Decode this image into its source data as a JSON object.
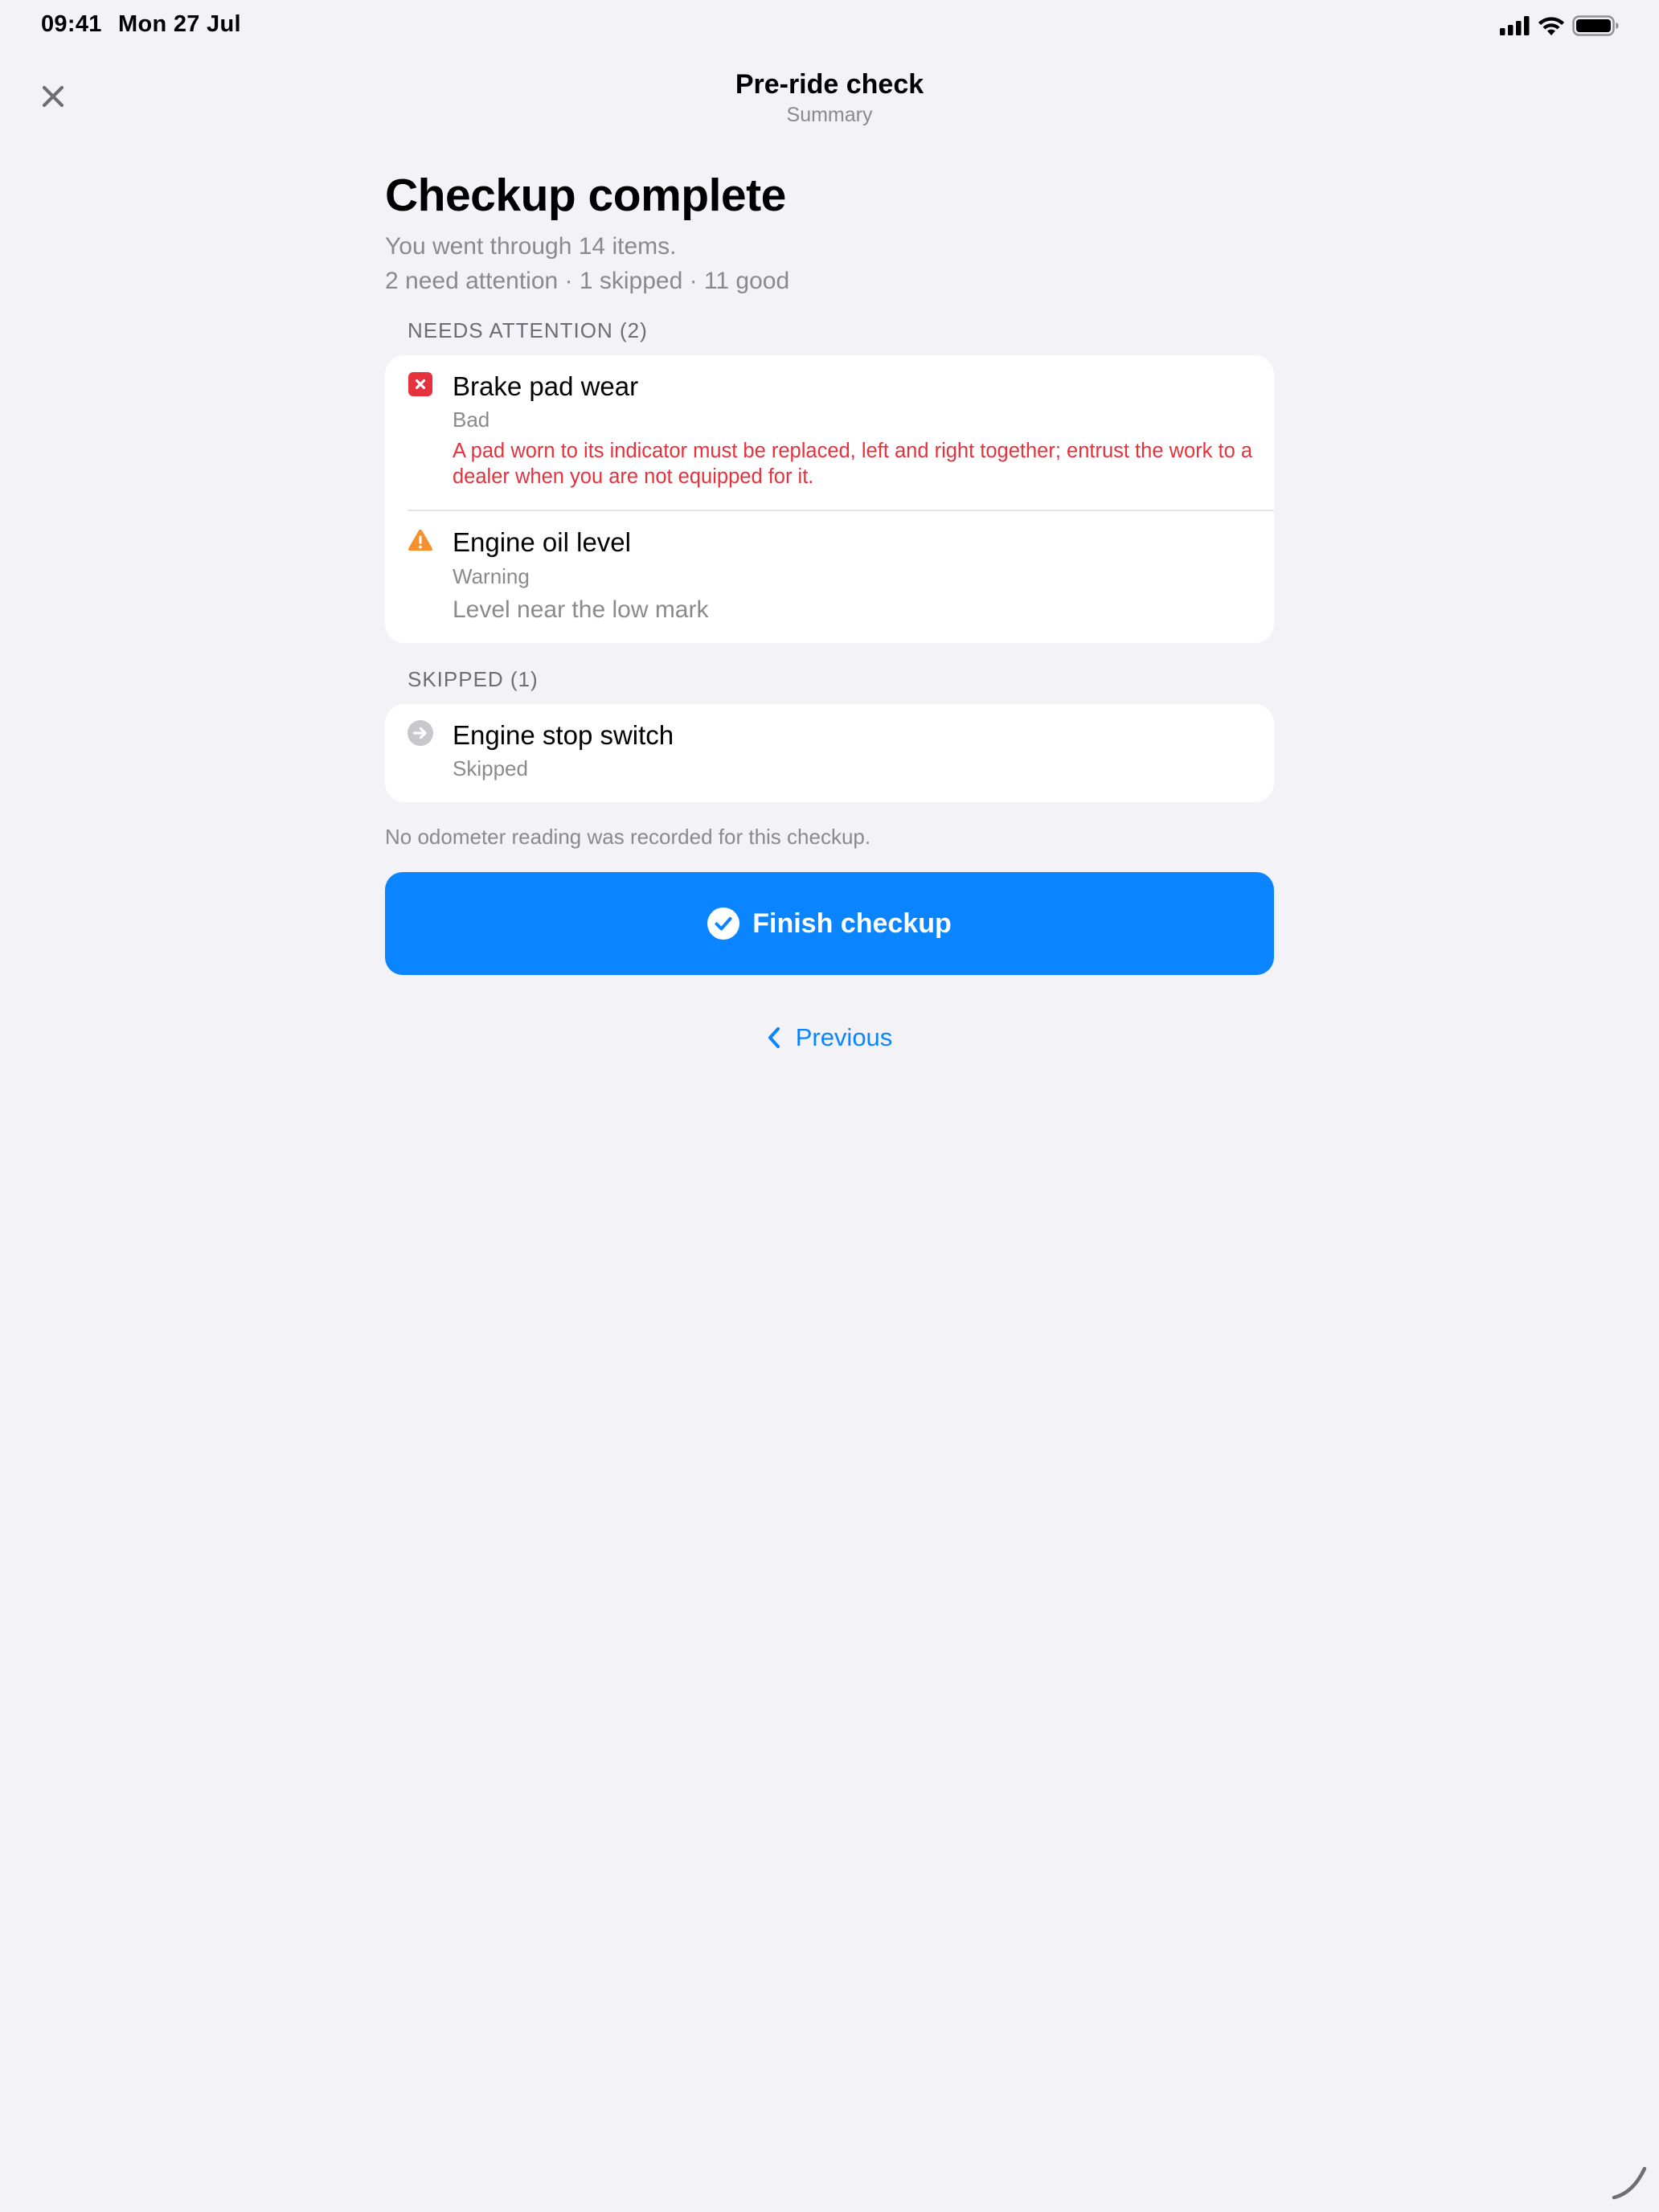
{
  "status_bar": {
    "time": "09:41",
    "date": "Mon 27 Jul",
    "icons": [
      "cellular-signal-icon",
      "wifi-icon",
      "battery-icon"
    ]
  },
  "nav": {
    "close_icon": "close-icon",
    "title": "Pre-ride check",
    "subtitle": "Summary"
  },
  "summary": {
    "title": "Checkup complete",
    "line1": "You went through 14 items.",
    "line2": "2 need attention · 1 skipped · 11 good"
  },
  "sections": {
    "needs_attention": {
      "header": "NEEDS ATTENTION (2)",
      "items": [
        {
          "icon": "error-x-icon",
          "title": "Brake pad wear",
          "status": "Bad",
          "note": "A pad worn to its indicator must be replaced, left and right together; entrust the work to a dealer when you are not equipped for it."
        },
        {
          "icon": "warning-triangle-icon",
          "title": "Engine oil level",
          "status": "Warning",
          "note": "Level near the low mark"
        }
      ]
    },
    "skipped": {
      "header": "SKIPPED (1)",
      "items": [
        {
          "icon": "skip-arrow-icon",
          "title": "Engine stop switch",
          "status": "Skipped"
        }
      ]
    }
  },
  "footnote": "No odometer reading was recorded for this checkup.",
  "actions": {
    "finish_label": "Finish checkup",
    "previous_label": "Previous"
  },
  "colors": {
    "background": "#F2F2F7",
    "accent": "#0A84FF",
    "bad": "#E5323C",
    "warning": "#F7902D",
    "skipped": "#C7C7CC"
  }
}
